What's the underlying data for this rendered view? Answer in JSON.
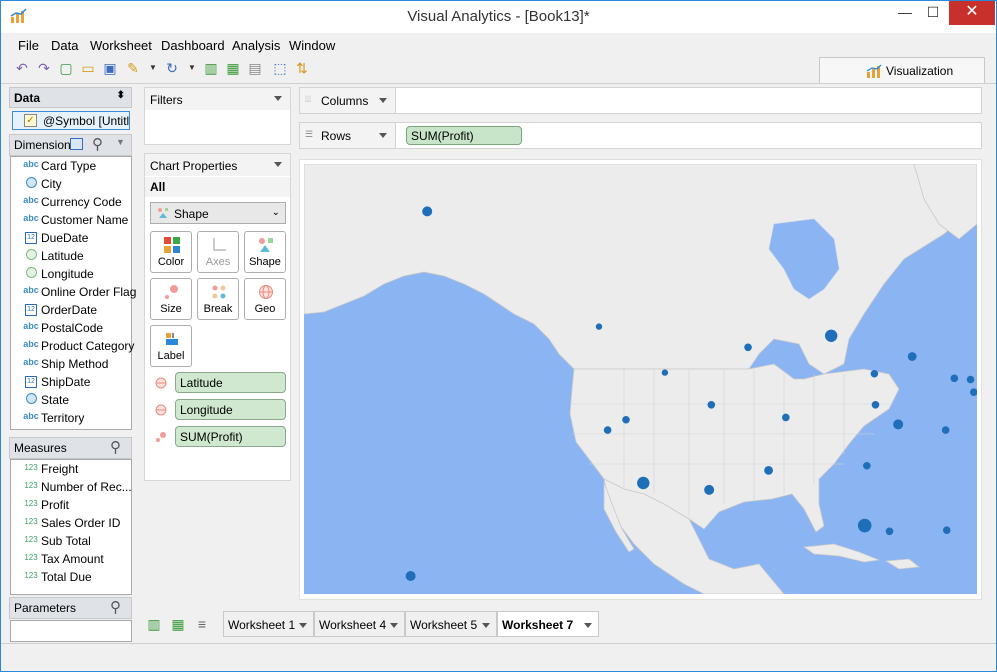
{
  "window": {
    "title": "Visual Analytics - [Book13]*"
  },
  "menu": [
    "File",
    "Data",
    "Worksheet",
    "Dashboard",
    "Analysis",
    "Window"
  ],
  "visualization_tab": {
    "label": "Visualization"
  },
  "data_panel": {
    "title": "Data",
    "datasource": "@Symbol [Untitl..."
  },
  "dimensions": {
    "title": "Dimensions",
    "items": [
      {
        "label": "Card Type",
        "icon": "abc"
      },
      {
        "label": "City",
        "icon": "globe"
      },
      {
        "label": "Currency Code",
        "icon": "abc"
      },
      {
        "label": "Customer Name",
        "icon": "abc"
      },
      {
        "label": "DueDate",
        "icon": "calendar"
      },
      {
        "label": "Latitude",
        "icon": "globe-green"
      },
      {
        "label": "Longitude",
        "icon": "globe-green"
      },
      {
        "label": "Online Order Flag",
        "icon": "abc"
      },
      {
        "label": "OrderDate",
        "icon": "calendar"
      },
      {
        "label": "PostalCode",
        "icon": "abc"
      },
      {
        "label": "Product Category",
        "icon": "abc"
      },
      {
        "label": "Ship Method",
        "icon": "abc"
      },
      {
        "label": "ShipDate",
        "icon": "calendar"
      },
      {
        "label": "State",
        "icon": "globe"
      },
      {
        "label": "Territory",
        "icon": "abc"
      }
    ]
  },
  "measures": {
    "title": "Measures",
    "items": [
      {
        "label": "Freight",
        "icon": "123"
      },
      {
        "label": "Number of Rec...",
        "icon": "123"
      },
      {
        "label": "Profit",
        "icon": "123"
      },
      {
        "label": "Sales Order ID",
        "icon": "123"
      },
      {
        "label": "Sub Total",
        "icon": "123"
      },
      {
        "label": "Tax Amount",
        "icon": "123"
      },
      {
        "label": "Total Due",
        "icon": "123"
      }
    ]
  },
  "parameters": {
    "title": "Parameters"
  },
  "filters": {
    "title": "Filters"
  },
  "chart_properties": {
    "title": "Chart Properties",
    "scope": "All",
    "mark_type": "Shape",
    "cards": [
      "Color",
      "Axes",
      "Shape",
      "Size",
      "Break",
      "Geo",
      "Label"
    ],
    "fields": [
      "Latitude",
      "Longitude",
      "SUM(Profit)"
    ]
  },
  "shelves": {
    "columns_label": "Columns",
    "rows_label": "Rows",
    "rows_pill": "SUM(Profit)"
  },
  "worksheets": [
    {
      "label": "Worksheet 1",
      "active": false
    },
    {
      "label": "Worksheet 4",
      "active": false
    },
    {
      "label": "Worksheet 5",
      "active": false
    },
    {
      "label": "Worksheet 7",
      "active": true
    }
  ],
  "colors": {
    "accent": "#2b87d8",
    "pill_green": "#c9e5c9",
    "ocean": "#8ab4f2",
    "land": "#ececec",
    "mark": "#1f6fb8"
  },
  "map_marks": [
    {
      "lon": -149.9,
      "lat": 61.2,
      "profit": 0.5
    },
    {
      "lon": -157.8,
      "lat": 21.3,
      "profit": 0.5
    },
    {
      "lon": -122.3,
      "lat": 47.6,
      "profit": 0.2
    },
    {
      "lon": -116.2,
      "lat": 43.6,
      "profit": 0.2
    },
    {
      "lon": -108.5,
      "lat": 45.8,
      "profit": 0.3
    },
    {
      "lon": -100.8,
      "lat": 46.8,
      "profit": 0.7
    },
    {
      "lon": -96.8,
      "lat": 43.5,
      "profit": 0.3
    },
    {
      "lon": -93.3,
      "lat": 45.0,
      "profit": 0.4
    },
    {
      "lon": -89.4,
      "lat": 43.1,
      "profit": 0.3
    },
    {
      "lon": -87.9,
      "lat": 43.0,
      "profit": 0.3
    },
    {
      "lon": -111.9,
      "lat": 40.8,
      "profit": 0.3
    },
    {
      "lon": -105.0,
      "lat": 39.7,
      "profit": 0.3
    },
    {
      "lon": -119.8,
      "lat": 39.5,
      "profit": 0.3
    },
    {
      "lon": -121.5,
      "lat": 38.6,
      "profit": 0.3
    },
    {
      "lon": -118.2,
      "lat": 34.0,
      "profit": 0.7
    },
    {
      "lon": -112.1,
      "lat": 33.4,
      "profit": 0.5
    },
    {
      "lon": -106.6,
      "lat": 35.1,
      "profit": 0.4
    },
    {
      "lon": -96.7,
      "lat": 40.8,
      "profit": 0.3
    },
    {
      "lon": -94.6,
      "lat": 39.1,
      "profit": 0.5
    },
    {
      "lon": -97.5,
      "lat": 35.5,
      "profit": 0.3
    },
    {
      "lon": -97.7,
      "lat": 30.3,
      "profit": 0.8
    },
    {
      "lon": -95.4,
      "lat": 29.8,
      "profit": 0.3
    },
    {
      "lon": -90.1,
      "lat": 29.9,
      "profit": 0.3
    },
    {
      "lon": -90.2,
      "lat": 38.6,
      "profit": 0.3
    },
    {
      "lon": -87.6,
      "lat": 41.9,
      "profit": 0.3
    },
    {
      "lon": -86.2,
      "lat": 39.8,
      "profit": 0.3
    },
    {
      "lon": -86.8,
      "lat": 36.2,
      "profit": 0.3
    },
    {
      "lon": -84.4,
      "lat": 33.7,
      "profit": 0.4
    },
    {
      "lon": -86.8,
      "lat": 33.5,
      "profit": 0.3
    },
    {
      "lon": -81.7,
      "lat": 30.3,
      "profit": 0.3
    },
    {
      "lon": -82.5,
      "lat": 28.0,
      "profit": 0.3
    },
    {
      "lon": -80.2,
      "lat": 25.8,
      "profit": 0.4
    },
    {
      "lon": -84.5,
      "lat": 39.1,
      "profit": 0.3
    },
    {
      "lon": -83.0,
      "lat": 40.0,
      "profit": 0.3
    },
    {
      "lon": -80.0,
      "lat": 40.4,
      "profit": 0.3
    },
    {
      "lon": -81.7,
      "lat": 41.5,
      "profit": 0.3
    },
    {
      "lon": -83.0,
      "lat": 42.3,
      "profit": 0.4
    },
    {
      "lon": -80.8,
      "lat": 35.2,
      "profit": 0.4
    },
    {
      "lon": -78.6,
      "lat": 35.8,
      "profit": 0.3
    },
    {
      "lon": -77.4,
      "lat": 37.5,
      "profit": 0.4
    },
    {
      "lon": -77.0,
      "lat": 38.9,
      "profit": 0.7
    },
    {
      "lon": -76.6,
      "lat": 39.3,
      "profit": 0.9
    },
    {
      "lon": -75.2,
      "lat": 39.9,
      "profit": 0.6
    },
    {
      "lon": -74.0,
      "lat": 40.7,
      "profit": 0.9
    },
    {
      "lon": -73.0,
      "lat": 41.3,
      "profit": 0.4
    },
    {
      "lon": -72.7,
      "lat": 41.8,
      "profit": 0.4
    },
    {
      "lon": -71.1,
      "lat": 42.4,
      "profit": 0.5
    },
    {
      "lon": -71.4,
      "lat": 41.8,
      "profit": 0.3
    },
    {
      "lon": -73.8,
      "lat": 42.7,
      "profit": 0.4
    },
    {
      "lon": -76.1,
      "lat": 43.0,
      "profit": 0.4
    },
    {
      "lon": -78.9,
      "lat": 42.9,
      "profit": 0.3
    }
  ]
}
